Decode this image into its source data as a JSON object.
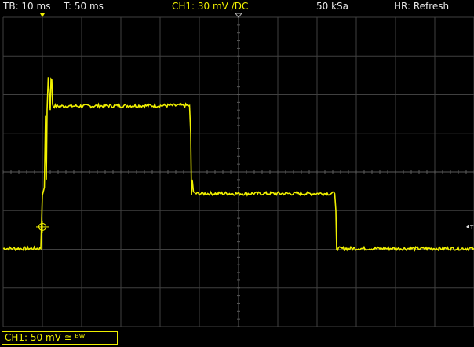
{
  "status": {
    "timebase": "TB: 10 ms",
    "trigger_time": "T: 50 ms",
    "channel": "CH1: 30 mV ∕DC",
    "sample_rate": "50 kSa",
    "hr_mode": "HR: Refresh"
  },
  "channel_info": "CH1: 50 mV ≅ ᴮᵂ",
  "trigger_level_label": "T",
  "colors": {
    "trace": "#f0f000",
    "grid": "#404040",
    "grid_dots": "#5a5a5a",
    "background": "#000000"
  },
  "chart_data": {
    "type": "line",
    "title": "",
    "xlabel": "",
    "ylabel": "",
    "grid": true,
    "x_divisions": 12,
    "y_divisions": 8,
    "units": {
      "x": "div",
      "y": "div"
    },
    "xlim": [
      -6,
      6
    ],
    "ylim": [
      -4,
      4
    ],
    "trigger_position_div": [
      -5,
      -1.42
    ],
    "series": [
      {
        "x": [
          -6,
          -5.04,
          -5.0,
          -4.95,
          -4.92,
          -4.9,
          -4.88,
          -4.85,
          -4.8,
          -4.78,
          -4.76,
          -4.74,
          -4.72,
          -1.25,
          -1.22,
          -1.2,
          -1.18,
          -1.15,
          -1.1,
          -1.05,
          2.45,
          2.48,
          2.5,
          6
        ],
        "y": [
          -1.98,
          -1.98,
          -0.6,
          -0.4,
          1.45,
          -0.2,
          1.6,
          2.45,
          1.6,
          2.42,
          2.38,
          1.75,
          1.7,
          1.72,
          1.0,
          -0.6,
          -0.2,
          -0.54,
          -0.56,
          -0.56,
          -0.56,
          -1.0,
          -1.98,
          -1.98
        ]
      }
    ]
  }
}
